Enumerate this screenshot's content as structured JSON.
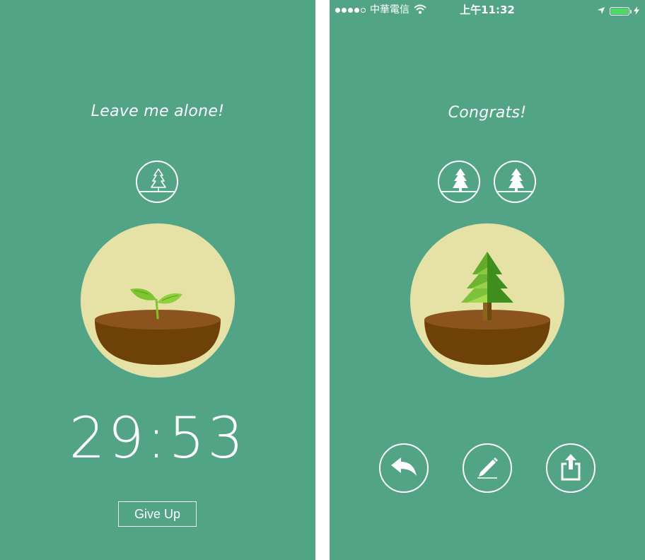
{
  "left_screen": {
    "message": "Leave me alone!",
    "timer": "29:53",
    "give_up_label": "Give Up",
    "tree_icons": [
      "tree-outline-icon"
    ],
    "plant": "seedling-icon"
  },
  "right_screen": {
    "status_bar": {
      "carrier": "中華電信",
      "time": "上午11:32",
      "signal_filled": 4,
      "signal_total": 5,
      "battery_level": 1.0,
      "icons": [
        "signal-dots-icon",
        "wifi-icon",
        "location-arrow-icon",
        "battery-icon",
        "charging-bolt-icon"
      ]
    },
    "message": "Congrats!",
    "tree_icons": [
      "tree-filled-icon",
      "tree-filled-icon"
    ],
    "plant": "pine-tree-icon",
    "actions": [
      "back-icon",
      "edit-pencil-icon",
      "share-icon"
    ]
  },
  "colors": {
    "background": "#52a486",
    "pot_circle": "#e6e2a6",
    "soil_top": "#8b541e",
    "soil_body": "#6e4108",
    "leaf": "#7ec42e",
    "battery": "#4cd964"
  }
}
